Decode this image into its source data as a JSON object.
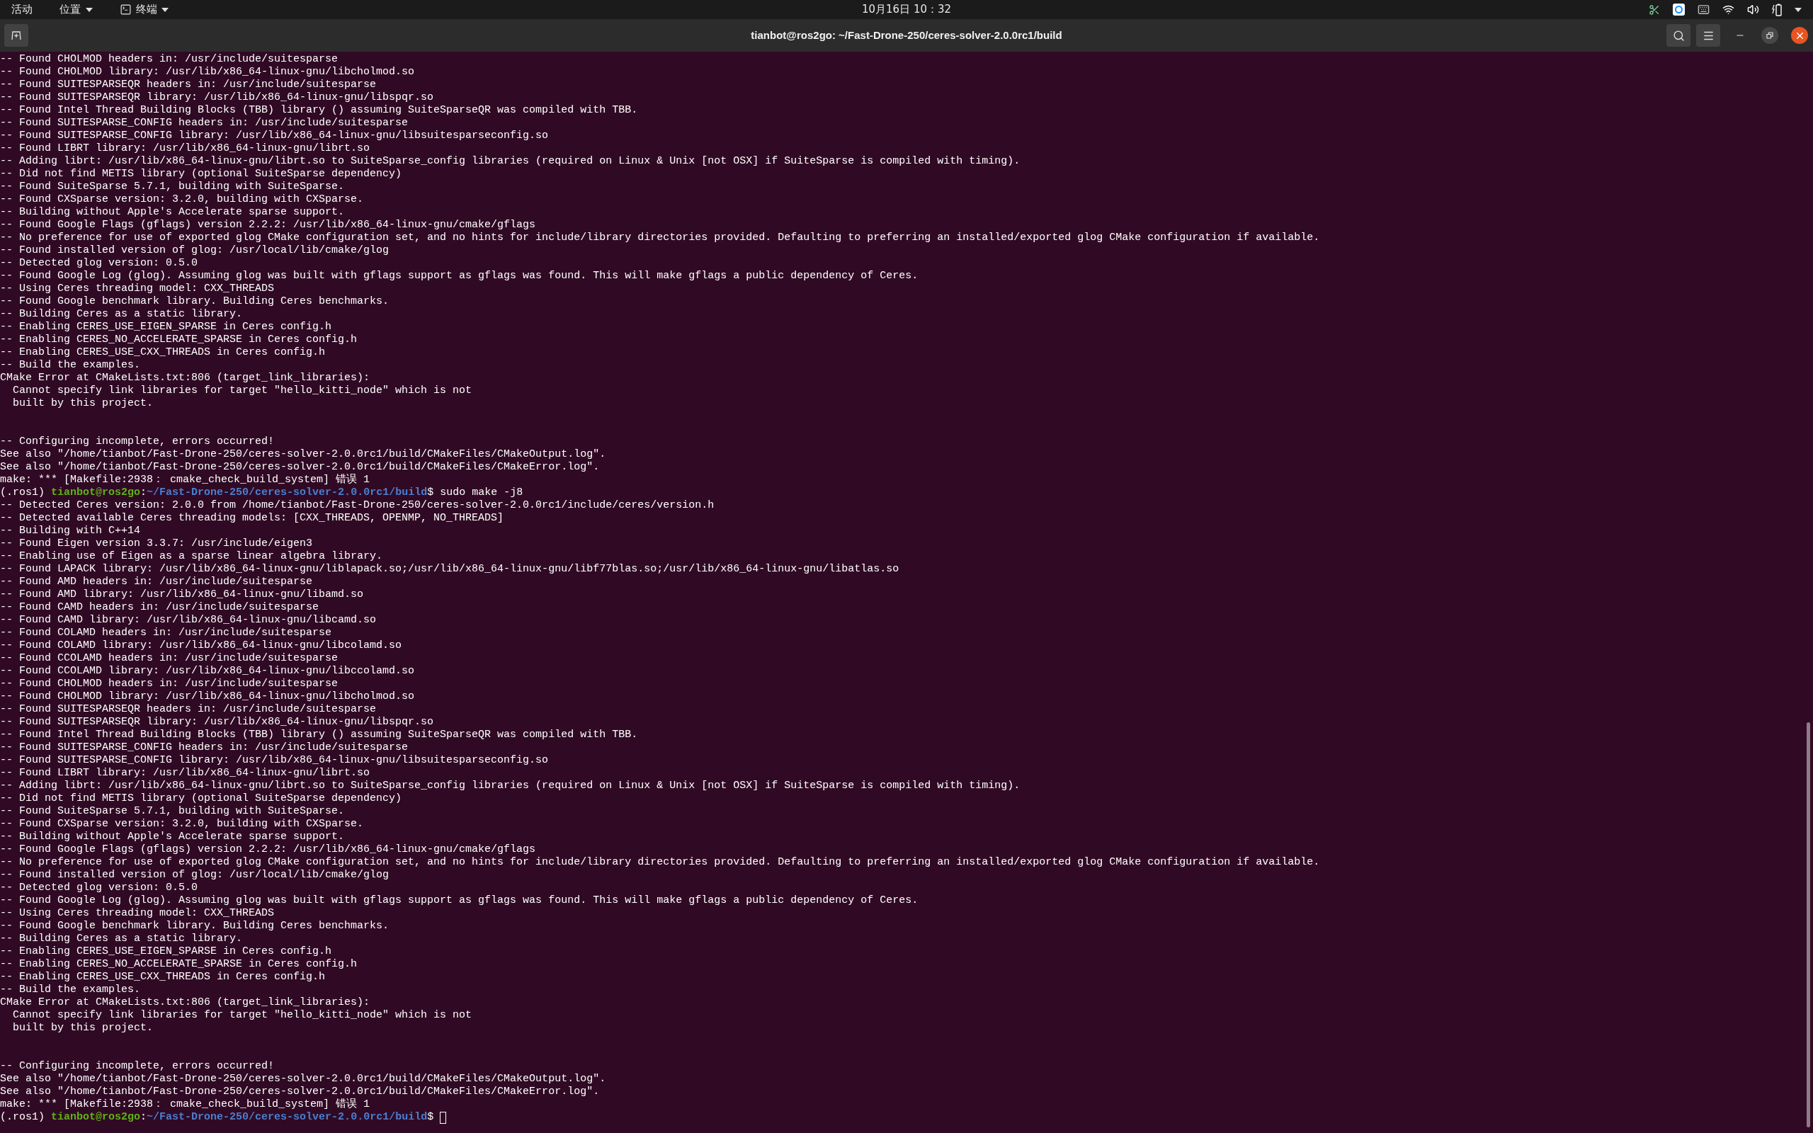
{
  "top_bar": {
    "activities": "活动",
    "places": "位置",
    "app_menu": "终端",
    "clock": "10月16日 10：32"
  },
  "window": {
    "title": "tianbot@ros2go: ~/Fast-Drone-250/ceres-solver-2.0.0rc1/build"
  },
  "terminal": {
    "lines": [
      {
        "kind": "output",
        "text": "-- Found CHOLMOD headers in: /usr/include/suitesparse"
      },
      {
        "kind": "output",
        "text": "-- Found CHOLMOD library: /usr/lib/x86_64-linux-gnu/libcholmod.so"
      },
      {
        "kind": "output",
        "text": "-- Found SUITESPARSEQR headers in: /usr/include/suitesparse"
      },
      {
        "kind": "output",
        "text": "-- Found SUITESPARSEQR library: /usr/lib/x86_64-linux-gnu/libspqr.so"
      },
      {
        "kind": "output",
        "text": "-- Found Intel Thread Building Blocks (TBB) library () assuming SuiteSparseQR was compiled with TBB."
      },
      {
        "kind": "output",
        "text": "-- Found SUITESPARSE_CONFIG headers in: /usr/include/suitesparse"
      },
      {
        "kind": "output",
        "text": "-- Found SUITESPARSE_CONFIG library: /usr/lib/x86_64-linux-gnu/libsuitesparseconfig.so"
      },
      {
        "kind": "output",
        "text": "-- Found LIBRT library: /usr/lib/x86_64-linux-gnu/librt.so"
      },
      {
        "kind": "output",
        "text": "-- Adding librt: /usr/lib/x86_64-linux-gnu/librt.so to SuiteSparse_config libraries (required on Linux & Unix [not OSX] if SuiteSparse is compiled with timing)."
      },
      {
        "kind": "output",
        "text": "-- Did not find METIS library (optional SuiteSparse dependency)"
      },
      {
        "kind": "output",
        "text": "-- Found SuiteSparse 5.7.1, building with SuiteSparse."
      },
      {
        "kind": "output",
        "text": "-- Found CXSparse version: 3.2.0, building with CXSparse."
      },
      {
        "kind": "output",
        "text": "-- Building without Apple's Accelerate sparse support."
      },
      {
        "kind": "output",
        "text": "-- Found Google Flags (gflags) version 2.2.2: /usr/lib/x86_64-linux-gnu/cmake/gflags"
      },
      {
        "kind": "output",
        "text": "-- No preference for use of exported glog CMake configuration set, and no hints for include/library directories provided. Defaulting to preferring an installed/exported glog CMake configuration if available."
      },
      {
        "kind": "output",
        "text": "-- Found installed version of glog: /usr/local/lib/cmake/glog"
      },
      {
        "kind": "output",
        "text": "-- Detected glog version: 0.5.0"
      },
      {
        "kind": "output",
        "text": "-- Found Google Log (glog). Assuming glog was built with gflags support as gflags was found. This will make gflags a public dependency of Ceres."
      },
      {
        "kind": "output",
        "text": "-- Using Ceres threading model: CXX_THREADS"
      },
      {
        "kind": "output",
        "text": "-- Found Google benchmark library. Building Ceres benchmarks."
      },
      {
        "kind": "output",
        "text": "-- Building Ceres as a static library."
      },
      {
        "kind": "output",
        "text": "-- Enabling CERES_USE_EIGEN_SPARSE in Ceres config.h"
      },
      {
        "kind": "output",
        "text": "-- Enabling CERES_NO_ACCELERATE_SPARSE in Ceres config.h"
      },
      {
        "kind": "output",
        "text": "-- Enabling CERES_USE_CXX_THREADS in Ceres config.h"
      },
      {
        "kind": "output",
        "text": "-- Build the examples."
      },
      {
        "kind": "output",
        "text": "CMake Error at CMakeLists.txt:806 (target_link_libraries):"
      },
      {
        "kind": "output",
        "text": "  Cannot specify link libraries for target \"hello_kitti_node\" which is not"
      },
      {
        "kind": "output",
        "text": "  built by this project."
      },
      {
        "kind": "blank"
      },
      {
        "kind": "blank"
      },
      {
        "kind": "output",
        "text": "-- Configuring incomplete, errors occurred!"
      },
      {
        "kind": "output",
        "text": "See also \"/home/tianbot/Fast-Drone-250/ceres-solver-2.0.0rc1/build/CMakeFiles/CMakeOutput.log\"."
      },
      {
        "kind": "output",
        "text": "See also \"/home/tianbot/Fast-Drone-250/ceres-solver-2.0.0rc1/build/CMakeFiles/CMakeError.log\"."
      },
      {
        "kind": "output",
        "text": "make: *** [Makefile:2938： cmake_check_build_system] 错误 1"
      },
      {
        "kind": "prompt",
        "env": "(.ros1)",
        "user_host": "tianbot@ros2go",
        "separator": ":",
        "path": "~/Fast-Drone-250/ceres-solver-2.0.0rc1/build",
        "symbol": "$",
        "command": "sudo make -j8",
        "cursor": false
      },
      {
        "kind": "output",
        "text": "-- Detected Ceres version: 2.0.0 from /home/tianbot/Fast-Drone-250/ceres-solver-2.0.0rc1/include/ceres/version.h"
      },
      {
        "kind": "output",
        "text": "-- Detected available Ceres threading models: [CXX_THREADS, OPENMP, NO_THREADS]"
      },
      {
        "kind": "output",
        "text": "-- Building with C++14"
      },
      {
        "kind": "output",
        "text": "-- Found Eigen version 3.3.7: /usr/include/eigen3"
      },
      {
        "kind": "output",
        "text": "-- Enabling use of Eigen as a sparse linear algebra library."
      },
      {
        "kind": "output",
        "text": "-- Found LAPACK library: /usr/lib/x86_64-linux-gnu/liblapack.so;/usr/lib/x86_64-linux-gnu/libf77blas.so;/usr/lib/x86_64-linux-gnu/libatlas.so"
      },
      {
        "kind": "output",
        "text": "-- Found AMD headers in: /usr/include/suitesparse"
      },
      {
        "kind": "output",
        "text": "-- Found AMD library: /usr/lib/x86_64-linux-gnu/libamd.so"
      },
      {
        "kind": "output",
        "text": "-- Found CAMD headers in: /usr/include/suitesparse"
      },
      {
        "kind": "output",
        "text": "-- Found CAMD library: /usr/lib/x86_64-linux-gnu/libcamd.so"
      },
      {
        "kind": "output",
        "text": "-- Found COLAMD headers in: /usr/include/suitesparse"
      },
      {
        "kind": "output",
        "text": "-- Found COLAMD library: /usr/lib/x86_64-linux-gnu/libcolamd.so"
      },
      {
        "kind": "output",
        "text": "-- Found CCOLAMD headers in: /usr/include/suitesparse"
      },
      {
        "kind": "output",
        "text": "-- Found CCOLAMD library: /usr/lib/x86_64-linux-gnu/libccolamd.so"
      },
      {
        "kind": "output",
        "text": "-- Found CHOLMOD headers in: /usr/include/suitesparse"
      },
      {
        "kind": "output",
        "text": "-- Found CHOLMOD library: /usr/lib/x86_64-linux-gnu/libcholmod.so"
      },
      {
        "kind": "output",
        "text": "-- Found SUITESPARSEQR headers in: /usr/include/suitesparse"
      },
      {
        "kind": "output",
        "text": "-- Found SUITESPARSEQR library: /usr/lib/x86_64-linux-gnu/libspqr.so"
      },
      {
        "kind": "output",
        "text": "-- Found Intel Thread Building Blocks (TBB) library () assuming SuiteSparseQR was compiled with TBB."
      },
      {
        "kind": "output",
        "text": "-- Found SUITESPARSE_CONFIG headers in: /usr/include/suitesparse"
      },
      {
        "kind": "output",
        "text": "-- Found SUITESPARSE_CONFIG library: /usr/lib/x86_64-linux-gnu/libsuitesparseconfig.so"
      },
      {
        "kind": "output",
        "text": "-- Found LIBRT library: /usr/lib/x86_64-linux-gnu/librt.so"
      },
      {
        "kind": "output",
        "text": "-- Adding librt: /usr/lib/x86_64-linux-gnu/librt.so to SuiteSparse_config libraries (required on Linux & Unix [not OSX] if SuiteSparse is compiled with timing)."
      },
      {
        "kind": "output",
        "text": "-- Did not find METIS library (optional SuiteSparse dependency)"
      },
      {
        "kind": "output",
        "text": "-- Found SuiteSparse 5.7.1, building with SuiteSparse."
      },
      {
        "kind": "output",
        "text": "-- Found CXSparse version: 3.2.0, building with CXSparse."
      },
      {
        "kind": "output",
        "text": "-- Building without Apple's Accelerate sparse support."
      },
      {
        "kind": "output",
        "text": "-- Found Google Flags (gflags) version 2.2.2: /usr/lib/x86_64-linux-gnu/cmake/gflags"
      },
      {
        "kind": "output",
        "text": "-- No preference for use of exported glog CMake configuration set, and no hints for include/library directories provided. Defaulting to preferring an installed/exported glog CMake configuration if available."
      },
      {
        "kind": "output",
        "text": "-- Found installed version of glog: /usr/local/lib/cmake/glog"
      },
      {
        "kind": "output",
        "text": "-- Detected glog version: 0.5.0"
      },
      {
        "kind": "output",
        "text": "-- Found Google Log (glog). Assuming glog was built with gflags support as gflags was found. This will make gflags a public dependency of Ceres."
      },
      {
        "kind": "output",
        "text": "-- Using Ceres threading model: CXX_THREADS"
      },
      {
        "kind": "output",
        "text": "-- Found Google benchmark library. Building Ceres benchmarks."
      },
      {
        "kind": "output",
        "text": "-- Building Ceres as a static library."
      },
      {
        "kind": "output",
        "text": "-- Enabling CERES_USE_EIGEN_SPARSE in Ceres config.h"
      },
      {
        "kind": "output",
        "text": "-- Enabling CERES_NO_ACCELERATE_SPARSE in Ceres config.h"
      },
      {
        "kind": "output",
        "text": "-- Enabling CERES_USE_CXX_THREADS in Ceres config.h"
      },
      {
        "kind": "output",
        "text": "-- Build the examples."
      },
      {
        "kind": "output",
        "text": "CMake Error at CMakeLists.txt:806 (target_link_libraries):"
      },
      {
        "kind": "output",
        "text": "  Cannot specify link libraries for target \"hello_kitti_node\" which is not"
      },
      {
        "kind": "output",
        "text": "  built by this project."
      },
      {
        "kind": "blank"
      },
      {
        "kind": "blank"
      },
      {
        "kind": "output",
        "text": "-- Configuring incomplete, errors occurred!"
      },
      {
        "kind": "output",
        "text": "See also \"/home/tianbot/Fast-Drone-250/ceres-solver-2.0.0rc1/build/CMakeFiles/CMakeOutput.log\"."
      },
      {
        "kind": "output",
        "text": "See also \"/home/tianbot/Fast-Drone-250/ceres-solver-2.0.0rc1/build/CMakeFiles/CMakeError.log\"."
      },
      {
        "kind": "output",
        "text": "make: *** [Makefile:2938： cmake_check_build_system] 错误 1"
      },
      {
        "kind": "prompt",
        "env": "(.ros1)",
        "user_host": "tianbot@ros2go",
        "separator": ":",
        "path": "~/Fast-Drone-250/ceres-solver-2.0.0rc1/build",
        "symbol": "$",
        "cursor": true
      }
    ]
  }
}
